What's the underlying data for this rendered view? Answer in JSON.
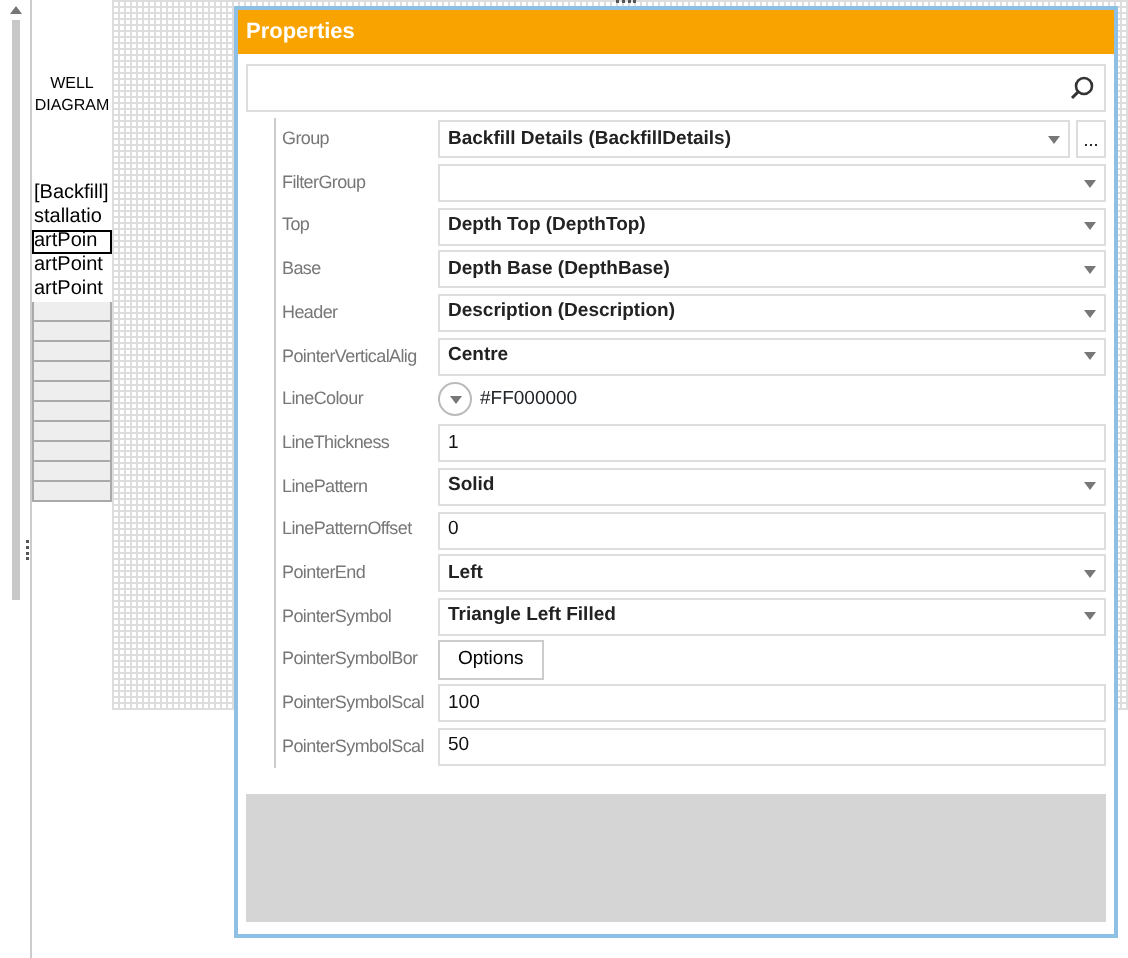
{
  "diagram": {
    "title": "WELL DIAGRAM",
    "items": [
      {
        "text": "[Backfill]",
        "selected": false
      },
      {
        "text": "stallatio",
        "selected": false
      },
      {
        "text": "artPoin",
        "selected": true
      },
      {
        "text": "artPoint",
        "selected": false
      },
      {
        "text": "artPoint",
        "selected": false
      }
    ]
  },
  "window": {
    "title": "Properties"
  },
  "properties": [
    {
      "label": "Group",
      "kind": "combo",
      "value": "Backfill Details (BackfillDetails)",
      "ellipsis": "..."
    },
    {
      "label": "FilterGroup",
      "kind": "combo"
    },
    {
      "label": "Top",
      "kind": "combo",
      "value": "Depth Top (DepthTop)"
    },
    {
      "label": "Base",
      "kind": "combo",
      "value": "Depth Base (DepthBase)"
    },
    {
      "label": "Header",
      "kind": "combo",
      "value": "Description (Description)"
    },
    {
      "label": "PointerVerticalAlig",
      "kind": "combo",
      "value": "Centre"
    },
    {
      "label": "LineColour",
      "kind": "color",
      "value": "#FF000000"
    },
    {
      "label": "LineThickness",
      "kind": "text",
      "value": "1"
    },
    {
      "label": "LinePattern",
      "kind": "combo",
      "value": "Solid"
    },
    {
      "label": "LinePatternOffset",
      "kind": "text",
      "value": "0"
    },
    {
      "label": "PointerEnd",
      "kind": "combo",
      "value": "Left"
    },
    {
      "label": "PointerSymbol",
      "kind": "combo",
      "value": "Triangle Left Filled"
    },
    {
      "label": "PointerSymbolBor",
      "kind": "button",
      "value": "Options"
    },
    {
      "label": "PointerSymbolScal",
      "kind": "text",
      "value": "100"
    },
    {
      "label": "PointerSymbolScal",
      "kind": "text",
      "value": "50"
    }
  ]
}
